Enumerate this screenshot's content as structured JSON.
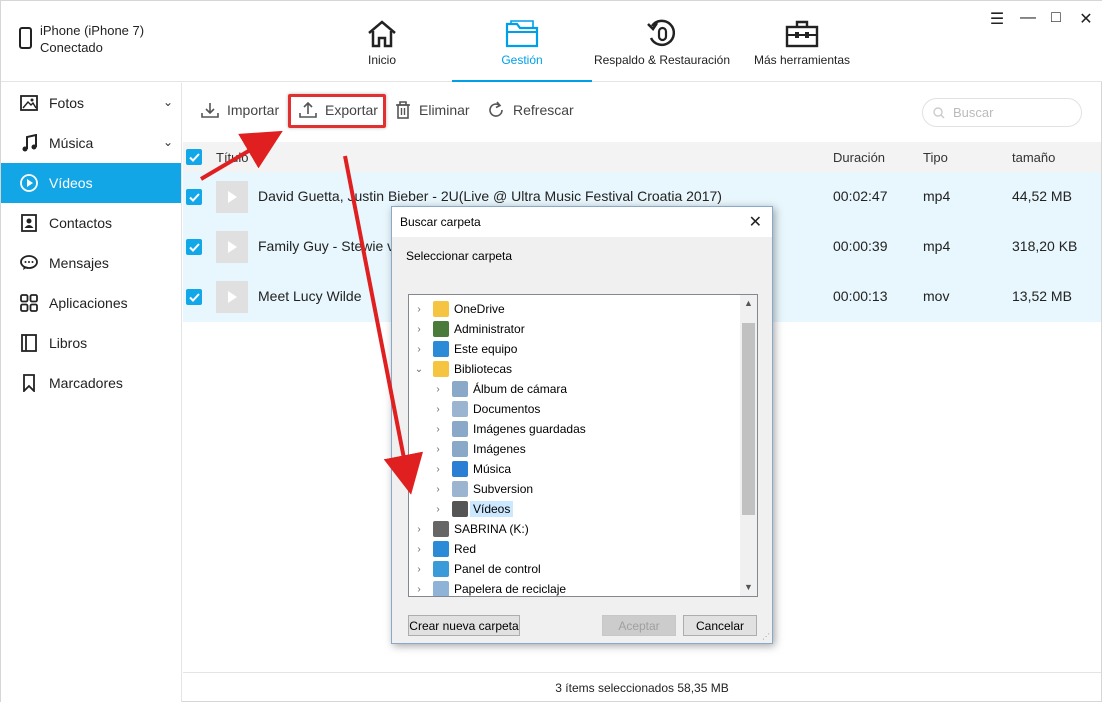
{
  "device": {
    "name": "iPhone (iPhone 7)",
    "status": "Conectado"
  },
  "nav": [
    {
      "label": "Inicio",
      "icon": "home-icon"
    },
    {
      "label": "Gestión",
      "icon": "folder-icon"
    },
    {
      "label": "Respaldo & Restauración",
      "icon": "restore-icon"
    },
    {
      "label": "Más herramientas",
      "icon": "toolbox-icon"
    }
  ],
  "window_controls": {
    "menu": "☰",
    "minimize": "—",
    "maximize": "□",
    "close": "✕"
  },
  "sidebar": {
    "items": [
      {
        "label": "Fotos",
        "icon": "photo-icon"
      },
      {
        "label": "Música",
        "icon": "music-icon"
      },
      {
        "label": "Vídeos",
        "icon": "video-icon"
      },
      {
        "label": "Contactos",
        "icon": "contact-icon"
      },
      {
        "label": "Mensajes",
        "icon": "message-icon"
      },
      {
        "label": "Aplicaciones",
        "icon": "apps-icon"
      },
      {
        "label": "Libros",
        "icon": "book-icon"
      },
      {
        "label": "Marcadores",
        "icon": "bookmark-icon"
      }
    ]
  },
  "toolbar": {
    "import": "Importar",
    "export": "Exportar",
    "delete": "Eliminar",
    "refresh": "Refrescar",
    "search_placeholder": "Buscar"
  },
  "table": {
    "headers": {
      "title": "Título",
      "duration": "Duración",
      "type": "Tipo",
      "size": "tamaño"
    },
    "rows": [
      {
        "title": "David Guetta, Justin Bieber - 2U(Live @ Ultra Music Festival Croatia 2017)",
        "duration": "00:02:47",
        "type": "mp4",
        "size": "44,52 MB"
      },
      {
        "title": "Family Guy - Stewie v",
        "duration": "00:00:39",
        "type": "mp4",
        "size": "318,20 KB"
      },
      {
        "title": "Meet Lucy Wilde",
        "duration": "00:00:13",
        "type": "mov",
        "size": "13,52 MB"
      }
    ]
  },
  "status": "3 ítems seleccionados 58,35 MB",
  "dialog": {
    "title": "Buscar carpeta",
    "prompt": "Seleccionar carpeta",
    "tree": [
      {
        "label": "OneDrive",
        "icon": "folder-icon",
        "level": 0,
        "expanded": false
      },
      {
        "label": "Administrator",
        "icon": "user-icon",
        "level": 0,
        "expanded": false
      },
      {
        "label": "Este equipo",
        "icon": "computer-icon",
        "level": 0,
        "expanded": false
      },
      {
        "label": "Bibliotecas",
        "icon": "library-icon",
        "level": 0,
        "expanded": true
      },
      {
        "label": "Álbum de cámara",
        "icon": "library-item-icon",
        "level": 1,
        "expanded": false
      },
      {
        "label": "Documentos",
        "icon": "documents-icon",
        "level": 1,
        "expanded": false
      },
      {
        "label": "Imágenes guardadas",
        "icon": "library-item-icon",
        "level": 1,
        "expanded": false
      },
      {
        "label": "Imágenes",
        "icon": "library-item-icon",
        "level": 1,
        "expanded": false
      },
      {
        "label": "Música",
        "icon": "music-library-icon",
        "level": 1,
        "expanded": false
      },
      {
        "label": "Subversion",
        "icon": "documents-icon",
        "level": 1,
        "expanded": false
      },
      {
        "label": "Vídeos",
        "icon": "video-library-icon",
        "level": 1,
        "expanded": false,
        "selected": true
      },
      {
        "label": "SABRINA (K:)",
        "icon": "drive-icon",
        "level": 0,
        "expanded": false
      },
      {
        "label": "Red",
        "icon": "network-icon",
        "level": 0,
        "expanded": false
      },
      {
        "label": "Panel de control",
        "icon": "control-panel-icon",
        "level": 0,
        "expanded": false
      },
      {
        "label": "Papelera de reciclaje",
        "icon": "recycle-bin-icon",
        "level": 0,
        "expanded": false
      }
    ],
    "buttons": {
      "new_folder": "Crear nueva carpeta",
      "accept": "Aceptar",
      "cancel": "Cancelar"
    }
  },
  "colors": {
    "accent": "#13a6e6",
    "highlight": "#e03030",
    "row_bg": "#e8f7fd"
  }
}
